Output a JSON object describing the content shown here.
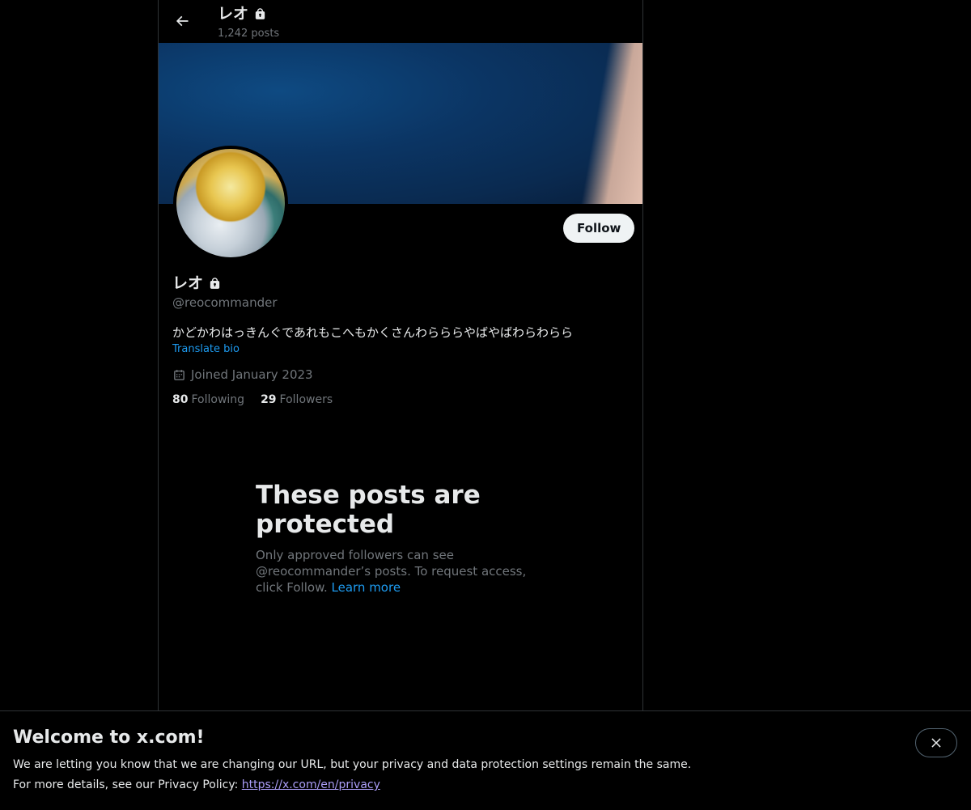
{
  "header": {
    "title": "レオ",
    "post_count": "1,242 posts"
  },
  "profile": {
    "display_name": "レオ",
    "handle": "@reocommander",
    "bio": "かどかわはっきんぐであれもこへもかくさんわらららやばやばわらわらら",
    "translate_label": "Translate bio",
    "joined": "Joined January 2023",
    "following_count": "80",
    "following_label": "Following",
    "followers_count": "29",
    "followers_label": "Followers",
    "follow_button": "Follow"
  },
  "protected": {
    "title": "These posts are protected",
    "text": "Only approved followers can see @reocommander’s posts. To request access, click Follow. ",
    "learn_more": "Learn more"
  },
  "notice": {
    "title": "Welcome to x.com!",
    "line1": "We are letting you know that we are changing our URL, but your privacy and data protection settings remain the same.",
    "line2_prefix": "For more details, see our Privacy Policy: ",
    "link": "https://x.com/en/privacy"
  },
  "icons": {
    "back": "arrow-left-icon",
    "lock": "lock-icon",
    "calendar": "calendar-icon",
    "close": "close-icon"
  },
  "colors": {
    "accent": "#1d9bf0",
    "muted": "#71767b",
    "link_visited": "#ab9ef8"
  }
}
